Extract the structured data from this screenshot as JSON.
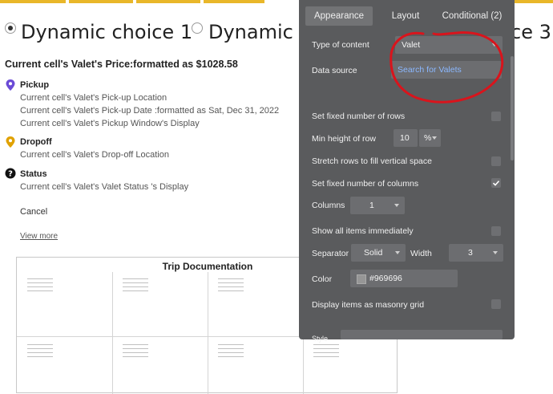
{
  "radios": [
    {
      "label": "Dynamic choice 1",
      "checked": true
    },
    {
      "label": "Dynamic ch",
      "checked": false
    },
    {
      "label": "ce 3",
      "checked": false
    }
  ],
  "content": {
    "price": "Current cell's Valet's Price:formatted as $1028.58",
    "pickup": {
      "title": "Pickup",
      "lines": [
        "Current cell's Valet's Pick-up Location",
        "Current cell's Valet's Pick-up Date :formatted as Sat, Dec 31, 2022",
        "Current cell's Valet's Pickup Window's Display"
      ]
    },
    "dropoff": {
      "title": "Dropoff",
      "lines": [
        "Current cell's Valet's Drop-off Location"
      ]
    },
    "status": {
      "title": "Status",
      "lines": [
        "Current cell's Valet's Valet Status 's Display"
      ]
    },
    "cancel": "Cancel",
    "view_more": "View more",
    "grid_title": "Trip Documentation"
  },
  "panel": {
    "tabs": [
      "Appearance",
      "Layout",
      "Conditional (2)"
    ],
    "active_tab": "Appearance",
    "type_of_content_label": "Type of content",
    "type_of_content_value": "Valet",
    "data_source_label": "Data source",
    "data_source_value": "Search for Valets",
    "set_fixed_rows_label": "Set fixed number of rows",
    "min_height_label": "Min height of row",
    "min_height_value": "10",
    "min_height_unit": "%",
    "stretch_rows_label": "Stretch rows to fill vertical space",
    "set_fixed_cols_label": "Set fixed number of columns",
    "set_fixed_cols_checked": true,
    "columns_label": "Columns",
    "columns_value": "1",
    "show_all_label": "Show all items immediately",
    "separator_label": "Separator",
    "separator_value": "Solid",
    "width_label": "Width",
    "width_value": "3",
    "color_label": "Color",
    "color_value": "#969696",
    "masonry_label": "Display items as masonry grid",
    "style_label": "Style"
  },
  "colors": {
    "accent_bar": "#e9b72a",
    "pickup_icon": "#6b4bd6",
    "dropoff_icon": "#e0a100",
    "annotation": "#d9141c",
    "link_blue": "#8bb8ff"
  },
  "icons": {
    "pickup": "map-pin-icon",
    "dropoff": "map-pin-icon",
    "status": "question-circle-icon",
    "checkmark": "check-icon"
  }
}
